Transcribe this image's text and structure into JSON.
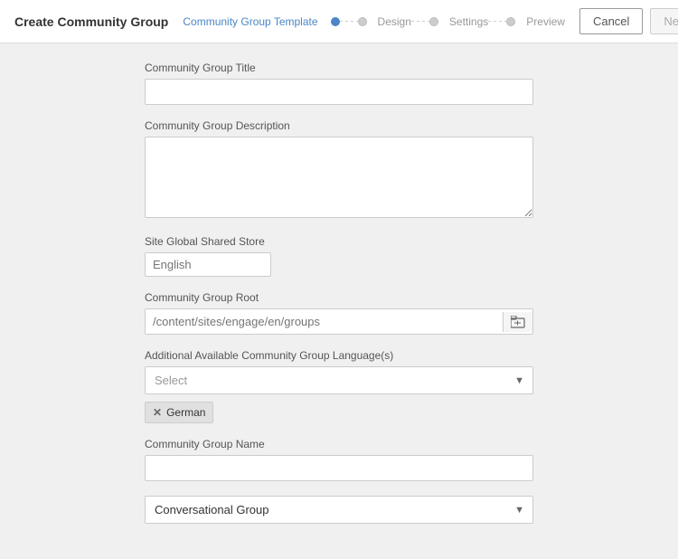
{
  "header": {
    "title": "Create Community Group",
    "cancel_label": "Cancel",
    "next_label": "Next"
  },
  "wizard": {
    "steps": [
      {
        "label": "Community Group Template",
        "state": "active"
      },
      {
        "label": "Design",
        "state": "inactive"
      },
      {
        "label": "Settings",
        "state": "inactive"
      },
      {
        "label": "Preview",
        "state": "inactive"
      }
    ]
  },
  "form": {
    "title_label": "Community Group Title",
    "title_placeholder": "",
    "description_label": "Community Group Description",
    "description_placeholder": "",
    "shared_store_label": "Site Global Shared Store",
    "shared_store_placeholder": "English",
    "root_label": "Community Group Root",
    "root_placeholder": "/content/sites/engage/en/groups",
    "languages_label": "Additional Available Community Group Language(s)",
    "languages_placeholder": "Select",
    "tags": [
      {
        "label": "German"
      }
    ],
    "name_label": "Community Group Name",
    "name_placeholder": "",
    "type_options": [
      {
        "label": "Conversational Group",
        "value": "conversational"
      }
    ],
    "type_selected": "Conversational Group"
  }
}
